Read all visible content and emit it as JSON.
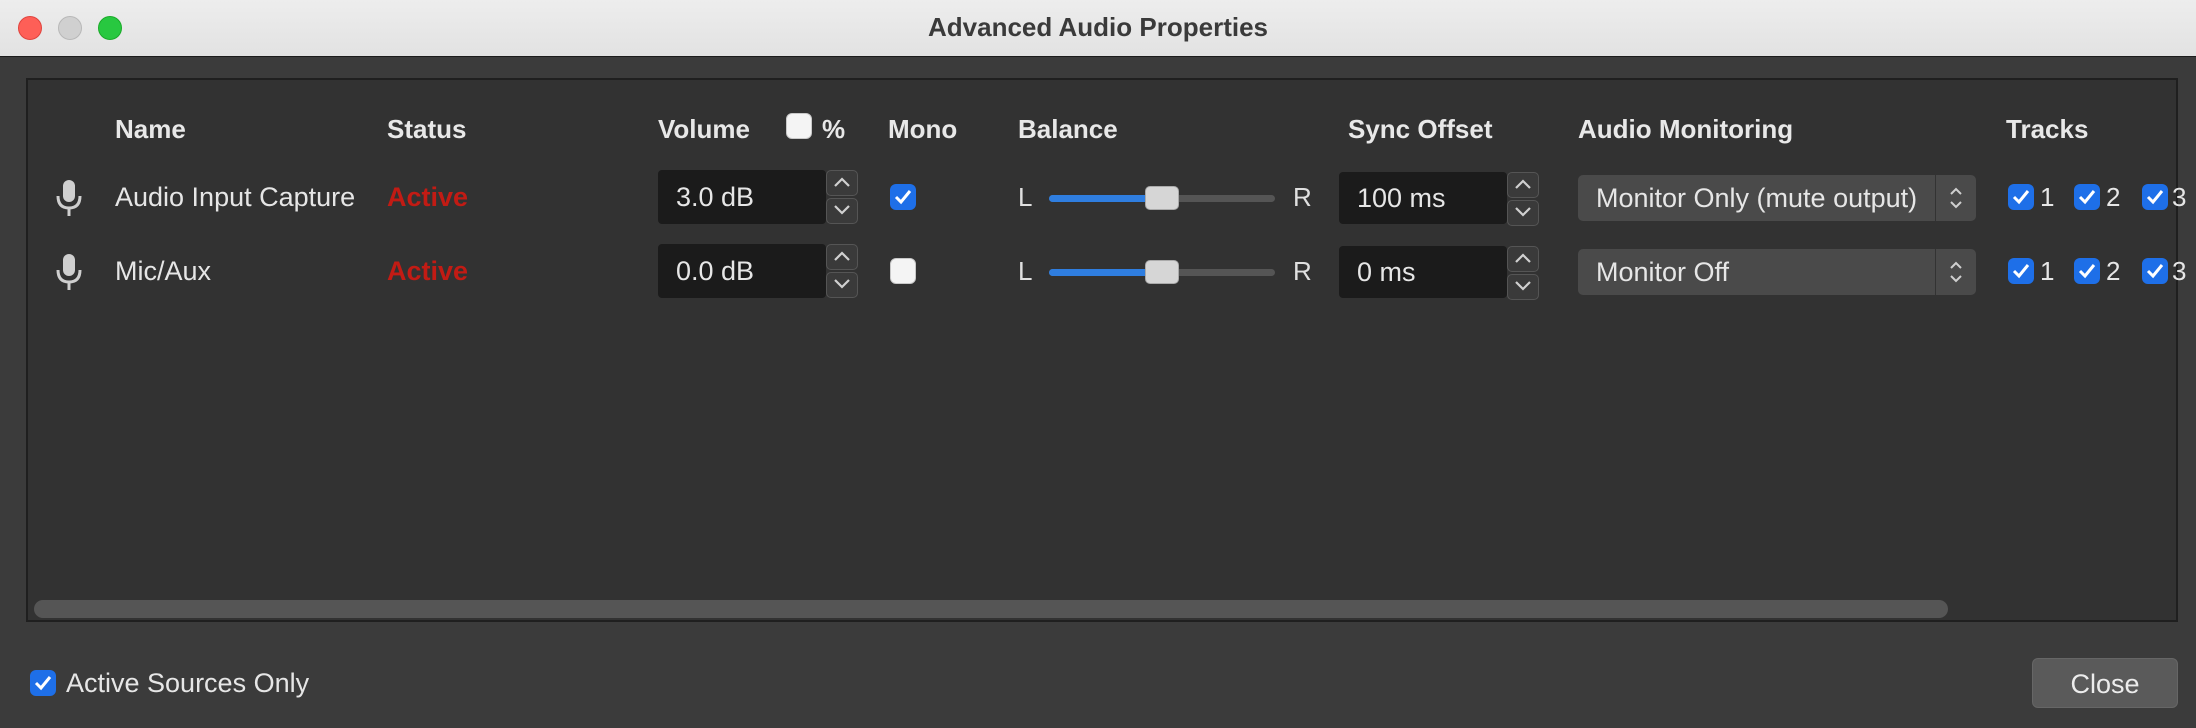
{
  "window": {
    "title": "Advanced Audio Properties"
  },
  "columns": {
    "name": "Name",
    "status": "Status",
    "volume": "Volume",
    "percent": "%",
    "mono": "Mono",
    "balance": "Balance",
    "sync_offset": "Sync Offset",
    "audio_monitoring": "Audio Monitoring",
    "tracks": "Tracks"
  },
  "balance_labels": {
    "left": "L",
    "right": "R"
  },
  "sources": [
    {
      "icon": "microphone-icon",
      "name": "Audio Input Capture",
      "status": "Active",
      "volume": "3.0 dB",
      "mono": true,
      "balance": 0.5,
      "sync_offset": "100 ms",
      "monitoring": "Monitor Only (mute output)",
      "tracks": [
        "1",
        "2",
        "3"
      ]
    },
    {
      "icon": "microphone-icon",
      "name": "Mic/Aux",
      "status": "Active",
      "volume": "0.0 dB",
      "mono": false,
      "balance": 0.5,
      "sync_offset": "0 ms",
      "monitoring": "Monitor Off",
      "tracks": [
        "1",
        "2",
        "3"
      ]
    }
  ],
  "footer": {
    "active_sources_only_label": "Active Sources Only",
    "active_sources_only_checked": true,
    "close_label": "Close"
  },
  "colors": {
    "status_active": "#c21b14",
    "accent": "#1e6fe8"
  }
}
